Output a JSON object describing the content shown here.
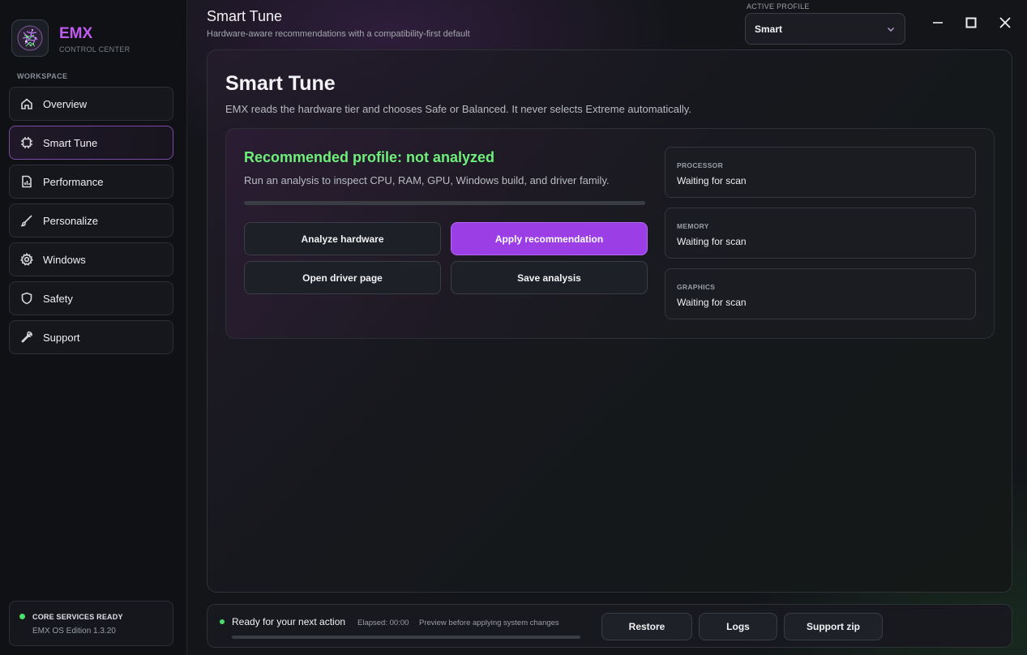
{
  "brand": {
    "name": "EMX",
    "subtitle": "CONTROL CENTER",
    "logo_icon": "circuit-logo-icon",
    "accent_color": "#c15bf0"
  },
  "sidebar": {
    "section_label": "WORKSPACE",
    "items": [
      {
        "label": "Overview",
        "icon": "home-icon"
      },
      {
        "label": "Smart Tune",
        "icon": "chip-icon",
        "active": true
      },
      {
        "label": "Performance",
        "icon": "chart-icon"
      },
      {
        "label": "Personalize",
        "icon": "brush-icon"
      },
      {
        "label": "Windows",
        "icon": "gear-icon"
      },
      {
        "label": "Safety",
        "icon": "shield-icon"
      },
      {
        "label": "Support",
        "icon": "wrench-icon"
      }
    ],
    "status": {
      "title": "CORE SERVICES READY",
      "subtitle": "EMX OS Edition 1.3.20",
      "color": "#4ade6a"
    }
  },
  "header": {
    "title": "Smart Tune",
    "subtitle": "Hardware-aware recommendations with a compatibility-first default",
    "profile_label": "ACTIVE PROFILE",
    "profile_value": "Smart"
  },
  "main": {
    "title": "Smart Tune",
    "description": "EMX reads the hardware tier and chooses Safe or Balanced. It never selects Extreme automatically.",
    "recommendation": {
      "title": "Recommended profile: not analyzed",
      "description": "Run an analysis to inspect CPU, RAM, GPU, Windows build, and driver family.",
      "progress": 0,
      "title_color": "#6ef07a"
    },
    "buttons": {
      "analyze": "Analyze hardware",
      "apply": "Apply recommendation",
      "driver": "Open driver page",
      "save": "Save analysis"
    },
    "hardware": [
      {
        "label": "PROCESSOR",
        "value": "Waiting for scan"
      },
      {
        "label": "MEMORY",
        "value": "Waiting for scan"
      },
      {
        "label": "GRAPHICS",
        "value": "Waiting for scan"
      }
    ]
  },
  "footer": {
    "status": "Ready for your next action",
    "elapsed": "Elapsed: 00:00",
    "preview": "Preview before applying system changes",
    "progress": 0,
    "buttons": {
      "restore": "Restore",
      "logs": "Logs",
      "support": "Support zip"
    }
  }
}
